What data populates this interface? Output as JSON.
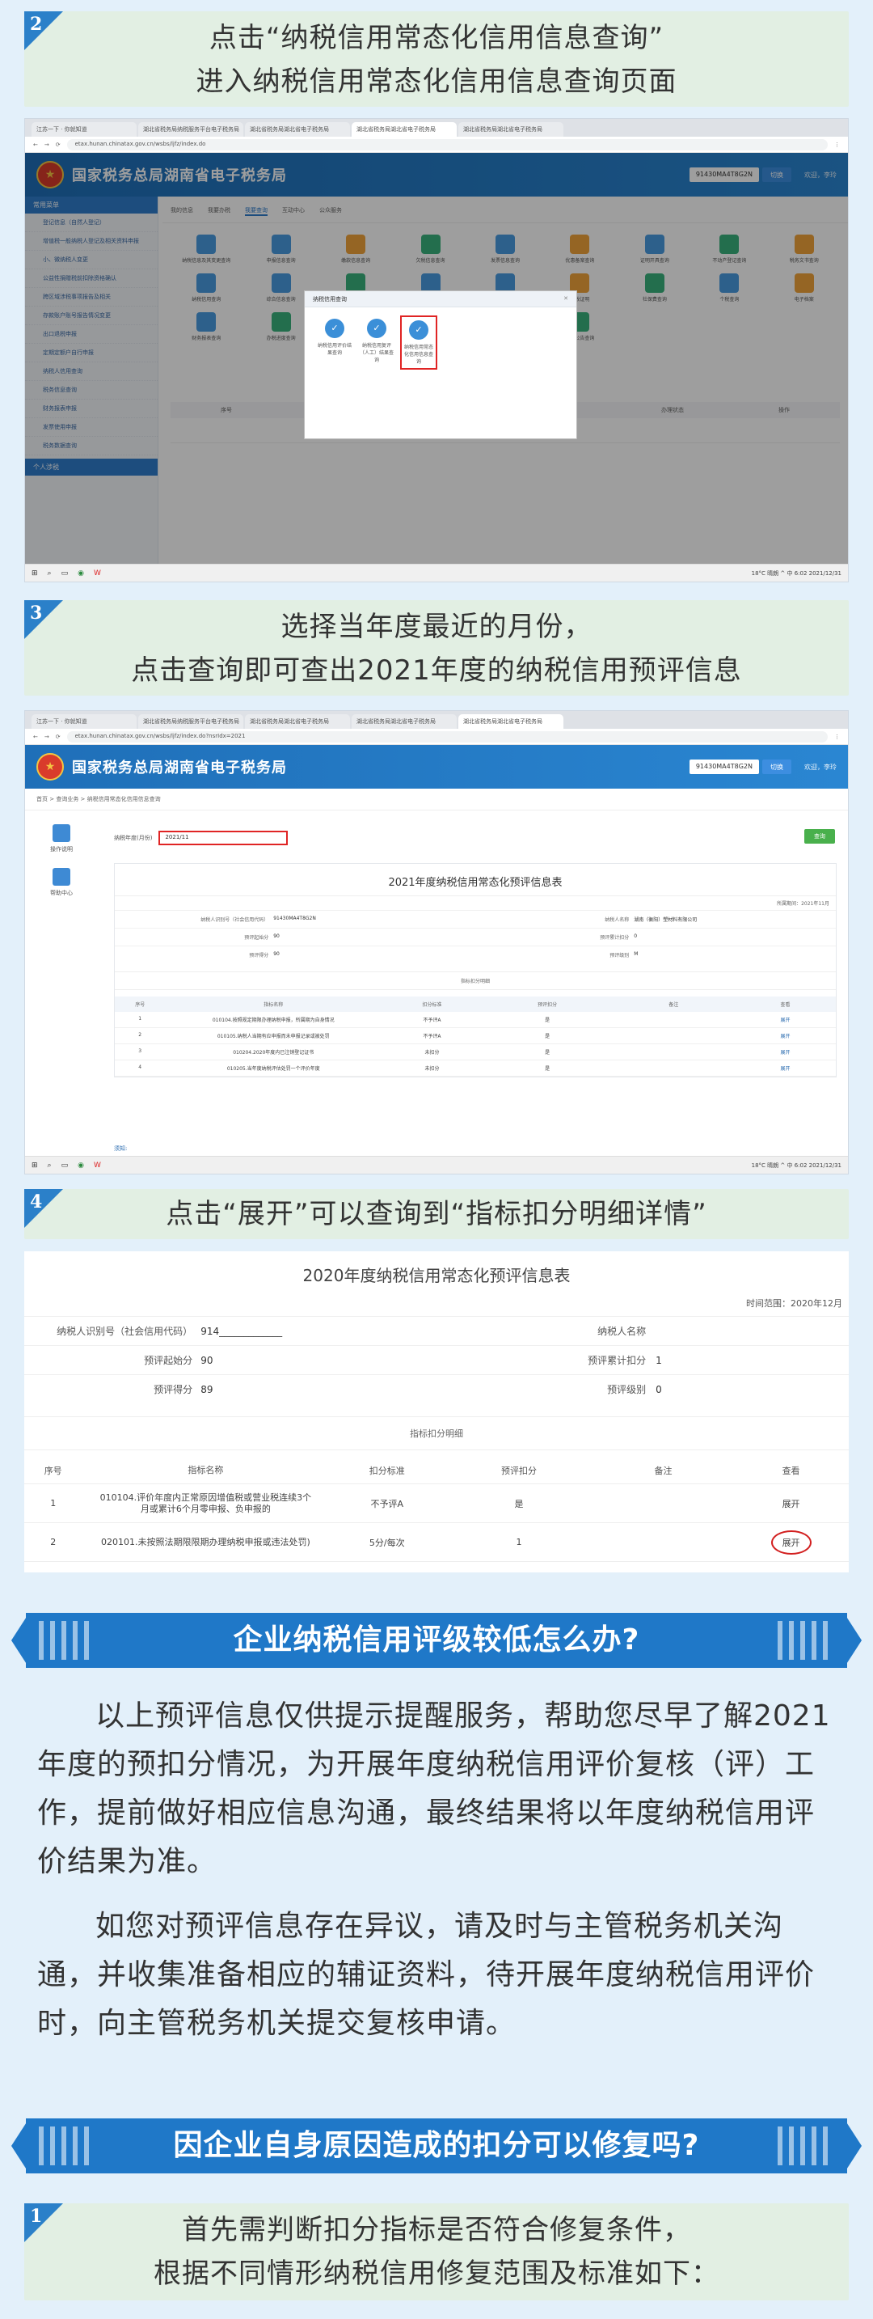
{
  "step2": {
    "num": "2",
    "line1": "点击“纳税信用常态化信用信息查询”",
    "line2": "进入纳税信用常态化信用信息查询页面"
  },
  "shot1": {
    "tabs": [
      "江苏一下 · 你就知道",
      "湖北省税务局纳税服务平台电子税务局",
      "湖北省税务局湖北省电子税务局",
      "湖北省税务局湖北省电子税务局",
      "湖北省税务局湖北省电子税务局"
    ],
    "url": "etax.hunan.chinatax.gov.cn/wsbs/ljfz/index.do",
    "site_title": "国家税务总局湖南省电子税务局",
    "taxpayer_id": "91430MA4T8G2N",
    "switch_btn": "切换",
    "user": "欢迎，李玲",
    "side_head": "常用菜单",
    "side_items": [
      "登记信息（自然人登记）",
      "增值税一般纳税人登记及相关资料申报",
      "小、微纳税人变更",
      "公益性捐赠税前扣除资格确认",
      "跨区域涉税事项报告及相关",
      "存款账户账号报告情况变更",
      "出口退税申报",
      "定期定额户自行申报",
      "纳税人信用查询",
      "税务信息查询",
      "财务报表申报",
      "发票使用申报",
      "税务数据查询"
    ],
    "side_head2": "个人涉税",
    "main_tabs": [
      "我的信息",
      "我要办税",
      "我要查询",
      "互动中心",
      "公众服务"
    ],
    "icons": [
      "纳税信息及其变更查询",
      "申报信息查询",
      "缴款信息查询",
      "欠税信息查询",
      "发票信息查询",
      "优惠备案查询",
      "证明开具查询",
      "不动产登记查询",
      "税务文书查询",
      "纳税信用查询",
      "综合信息查询",
      "出口退税查询",
      "涉税专业服务",
      "纳税人状态查询",
      "税收证明",
      "社保费查询",
      "个税查询",
      "电子档案",
      "财务报表查询",
      "办税进度查询",
      "涉税事项查询",
      "统计信息查询",
      "非居民查询",
      "通知公告查询"
    ],
    "table_cols": [
      "序号",
      "办理事项",
      "办理状态",
      "处理时间",
      "办理状态",
      "操作"
    ],
    "table_empty": "无查询数据记录",
    "dialog": {
      "title": "纳税信用查询",
      "items": [
        "纳税信用评价结果查询",
        "纳税信用复评（人工）结果查询",
        "纳税信用常态化信用信息查询"
      ]
    },
    "taskbar_tray": "18°C 晴朗 ^ 中 6:02 2021/12/31"
  },
  "step3": {
    "num": "3",
    "line1": "选择当年度最近的月份，",
    "line2": "点击查询即可查出2021年度的纳税信用预评信息"
  },
  "shot2": {
    "url": "etax.hunan.chinatax.gov.cn/wsbs/ljfz/index.do?nsrIdx=2021",
    "crumb": "首页 > 查询业务 > 纳税信用常态化信用信息查询",
    "left_items": [
      "操作说明",
      "帮助中心"
    ],
    "form_label": "纳税年度(月份)",
    "form_value": "2021/11",
    "query_btn": "查询",
    "card_title": "2021年度纳税信用常态化预评信息表",
    "period": "所属期间：2021年11月",
    "rows": [
      {
        "k1": "纳税人识别号（社会信用代码）",
        "v1": "91430MA4T8G2N",
        "k2": "纳税人名称",
        "v2": "湖南（衡阳）塑材料有限公司"
      },
      {
        "k1": "预评起始分",
        "v1": "90",
        "k2": "预评累计扣分",
        "v2": "0"
      },
      {
        "k1": "预评得分",
        "v1": "90",
        "k2": "预评级别",
        "v2": "M"
      }
    ],
    "sub_title": "指标扣分明细",
    "cols": [
      "序号",
      "指标名称",
      "扣分标准",
      "预评扣分",
      "备注",
      "查看"
    ],
    "items": [
      {
        "no": "1",
        "name": "010104.按照规定期限办理纳税申报，所属期为自身情况",
        "std": "不予评A",
        "deduct": "是",
        "remark": "",
        "view": "展开"
      },
      {
        "no": "2",
        "name": "010105.纳税人当期有应申报而未申报记录或被处罚",
        "std": "不予评A",
        "deduct": "是",
        "remark": "",
        "view": "展开"
      },
      {
        "no": "3",
        "name": "010204.2020年度内已注销登记证书",
        "std": "未扣分",
        "deduct": "是",
        "remark": "",
        "view": "展开"
      },
      {
        "no": "4",
        "name": "010205.当年度纳税评估处罚一个评价年度",
        "std": "未扣分",
        "deduct": "是",
        "remark": "",
        "view": "展开"
      }
    ],
    "notice": "须知:"
  },
  "step4": {
    "num": "4",
    "line1": "点击“展开”可以查询到“指标扣分明细详情”"
  },
  "shot3": {
    "title": "2020年度纳税信用常态化预评信息表",
    "period": "时间范围：2020年12月",
    "rows": [
      {
        "k1": "纳税人识别号（社会信用代码）",
        "v1": "914_____________",
        "k2": "纳税人名称",
        "v2": ""
      },
      {
        "k1": "预评起始分",
        "v1": "90",
        "k2": "预评累计扣分",
        "v2": "1"
      },
      {
        "k1": "预评得分",
        "v1": "89",
        "k2": "预评级别",
        "v2": "0"
      }
    ],
    "sub_title": "指标扣分明细",
    "cols": [
      "序号",
      "指标名称",
      "扣分标准",
      "预评扣分",
      "备注",
      "查看"
    ],
    "items": [
      {
        "no": "1",
        "name": "010104.评价年度内正常原因增值税或营业税连续3个月或累计6个月零申报、负申报的",
        "std": "不予评A",
        "deduct": "是",
        "remark": "",
        "view": "展开"
      },
      {
        "no": "2",
        "name": "020101.未按照法期限限期办理纳税申报或违法处罚)",
        "std": "5分/每次",
        "deduct": "1",
        "remark": "",
        "view": "展开"
      }
    ]
  },
  "banner1": "企业纳税信用评级较低怎么办?",
  "para1": "以上预评信息仅供提示提醒服务，帮助您尽早了解2021年度的预扣分情况，为开展年度纳税信用评价复核（评）工作，提前做好相应信息沟通，最终结果将以年度纳税信用评价结果为准。",
  "para2": "如您对预评信息存在异议，请及时与主管税务机关沟通，并收集准备相应的辅证资料，待开展年度纳税信用评价时，向主管税务机关提交复核申请。",
  "banner2": "因企业自身原因造成的扣分可以修复吗?",
  "step1": {
    "num": "1",
    "line1": "首先需判断扣分指标是否符合修复条件，",
    "line2": "根据不同情形纳税信用修复范围及标准如下："
  },
  "colors": {
    "accent": "#1f78c8",
    "highlight": "#e02424",
    "step_bg": "#e2efe3",
    "page_bg": "#e3f0fa"
  }
}
